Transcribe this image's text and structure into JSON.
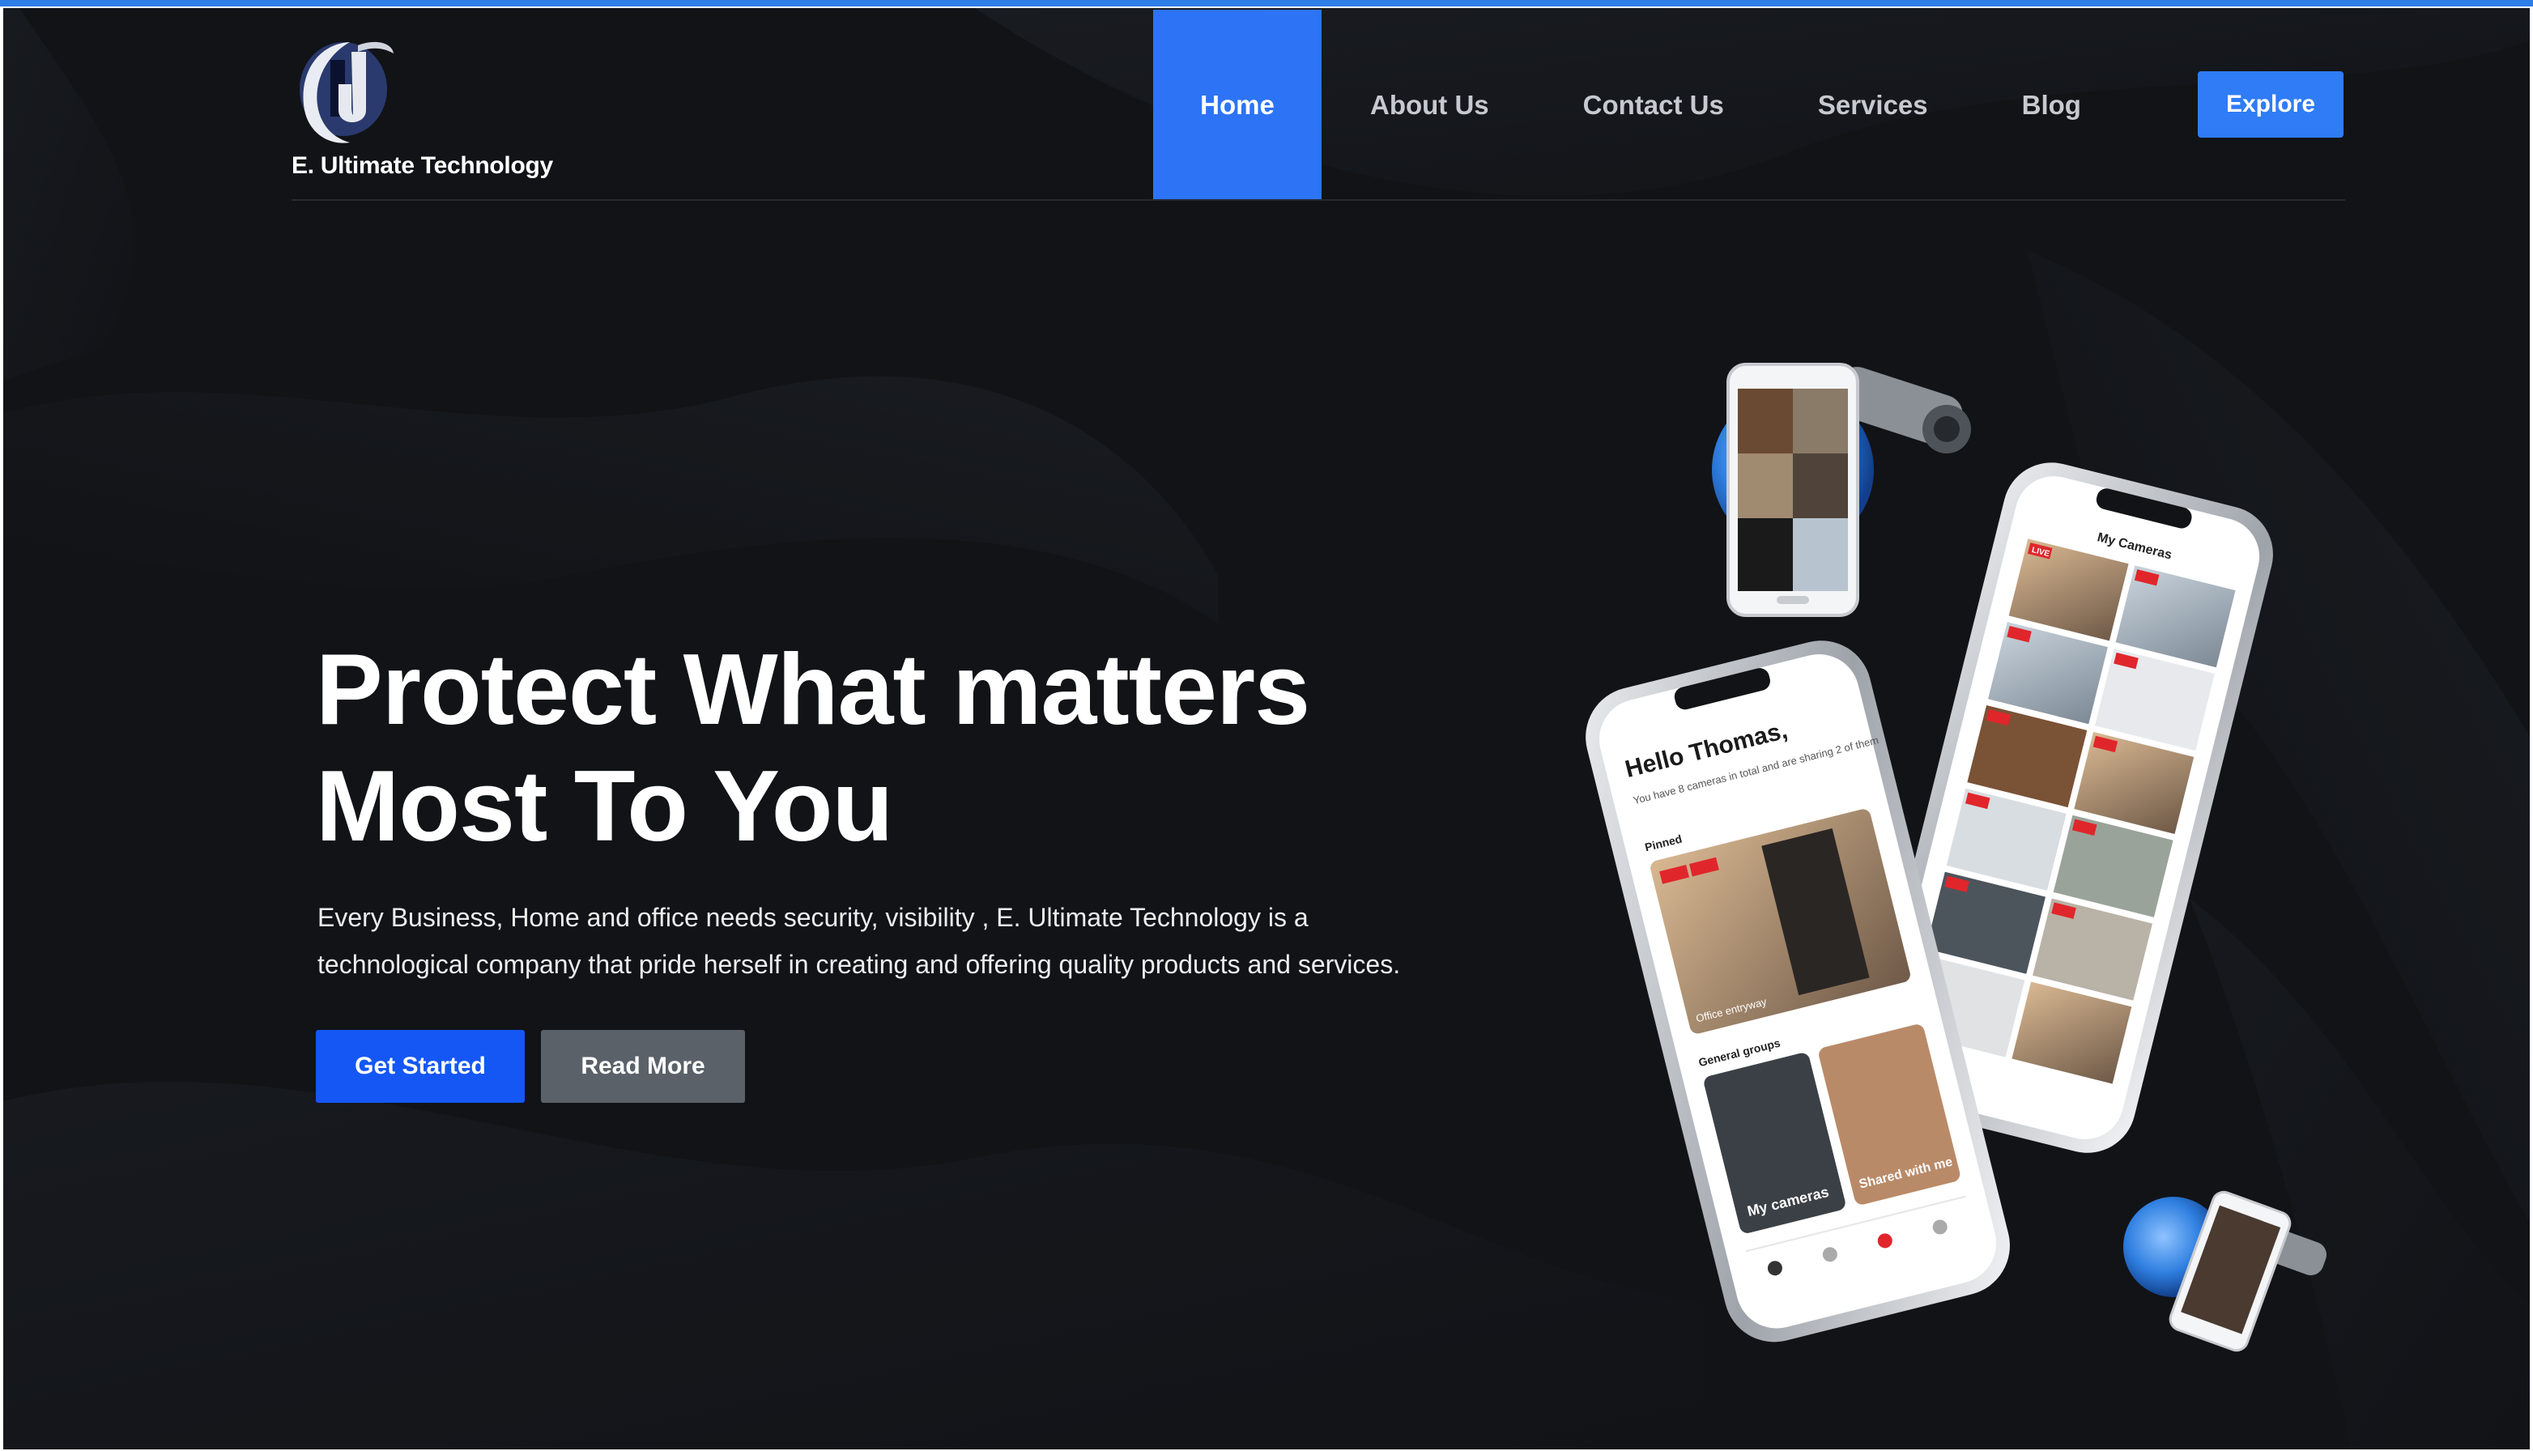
{
  "brand": {
    "name": "E. Ultimate Technology",
    "logo_icon": "eu-logo-icon"
  },
  "nav": {
    "items": [
      {
        "label": "Home",
        "active": true
      },
      {
        "label": "About Us",
        "active": false
      },
      {
        "label": "Contact Us",
        "active": false
      },
      {
        "label": "Services",
        "active": false
      },
      {
        "label": "Blog",
        "active": false
      }
    ],
    "cta_label": "Explore"
  },
  "hero": {
    "title_line1": "Protect What matters",
    "title_line2": "Most To You",
    "description_line1": "Every Business, Home and office needs security, visibility , E. Ultimate Technology is a",
    "description_line2": "technological company that  pride herself in creating and offering quality products and services.",
    "primary_button": "Get Started",
    "secondary_button": "Read More"
  },
  "illustration": {
    "front_phone": {
      "greeting": "Hello Thomas,",
      "subtitle": "You have 8 cameras in total and are sharing 2 of them",
      "pinned_label": "Pinned",
      "pinned_caption": "Office entryway",
      "groups_label": "General groups",
      "group_1": "My cameras",
      "group_2": "Shared with me"
    },
    "back_phone": {
      "title": "My Cameras",
      "live_badge": "LIVE"
    }
  },
  "colors": {
    "background": "#111317",
    "accent": "#2d73f6",
    "primary_button": "#1457f5",
    "secondary_button": "#5a6169",
    "live_badge": "#e0262b"
  }
}
